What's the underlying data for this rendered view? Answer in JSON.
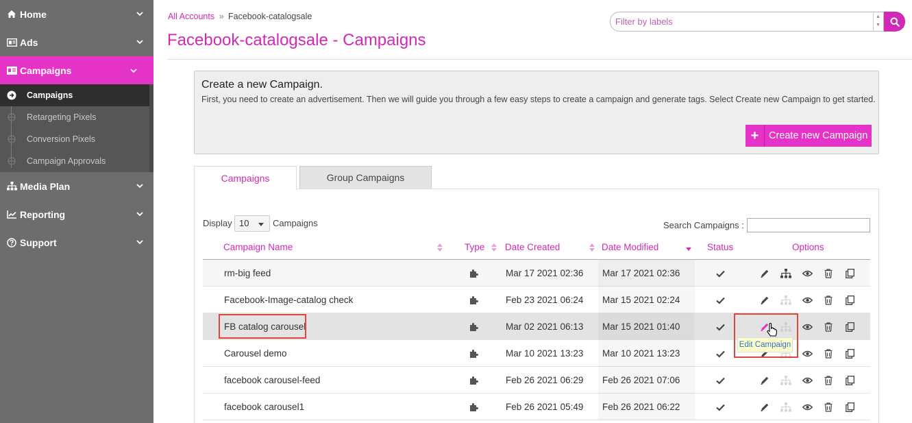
{
  "sidebar": {
    "items": [
      {
        "label": "Home"
      },
      {
        "label": "Ads"
      },
      {
        "label": "Campaigns"
      },
      {
        "label": "Media Plan"
      },
      {
        "label": "Reporting"
      },
      {
        "label": "Support"
      }
    ],
    "sub_items": [
      {
        "label": "Campaigns"
      },
      {
        "label": "Retargeting Pixels"
      },
      {
        "label": "Conversion Pixels"
      },
      {
        "label": "Campaign Approvals"
      }
    ]
  },
  "breadcrumb": {
    "root": "All Accounts",
    "separator": "»",
    "current": "Facebook-catalogsale"
  },
  "page_title": "Facebook-catalogsale - Campaigns",
  "filter": {
    "placeholder": "Filter by labels"
  },
  "create_panel": {
    "title": "Create a new Campaign.",
    "description": "First, you need to create an advertisement. Then we will guide you through a few easy steps to create a campaign and generate tags. Select Create new Campaign to get started.",
    "button_label": "Create new Campaign"
  },
  "tabs": [
    {
      "label": "Campaigns"
    },
    {
      "label": "Group Campaigns"
    }
  ],
  "controls": {
    "display_label": "Display",
    "display_value": "10",
    "campaigns_label": "Campaigns",
    "search_label": "Search Campaigns :"
  },
  "table": {
    "headers": [
      "Campaign Name",
      "Type",
      "Date Created",
      "Date Modified",
      "Status",
      "Options"
    ],
    "rows": [
      {
        "name": "rm-big feed",
        "created": "Mar 17 2021 02:36",
        "modified": "Mar 17 2021 02:36"
      },
      {
        "name": "Facebook-Image-catalog check",
        "created": "Feb 23 2021 06:24",
        "modified": "Mar 15 2021 02:24"
      },
      {
        "name": "FB catalog carousel",
        "created": "Mar 02 2021 06:13",
        "modified": "Mar 15 2021 01:40"
      },
      {
        "name": "Carousel demo",
        "created": "Mar 10 2021 13:23",
        "modified": "Mar 10 2021 13:23"
      },
      {
        "name": "facebook carousel-feed",
        "created": "Feb 26 2021 06:29",
        "modified": "Feb 26 2021 07:06"
      },
      {
        "name": "facebook carousel1",
        "created": "Feb 26 2021 05:49",
        "modified": "Feb 26 2021 06:22"
      }
    ]
  },
  "tooltip": "Edit Campaign",
  "colors": {
    "accent": "#e532c7",
    "link": "#d12ab8",
    "sidebar": "#6d6d6d"
  }
}
